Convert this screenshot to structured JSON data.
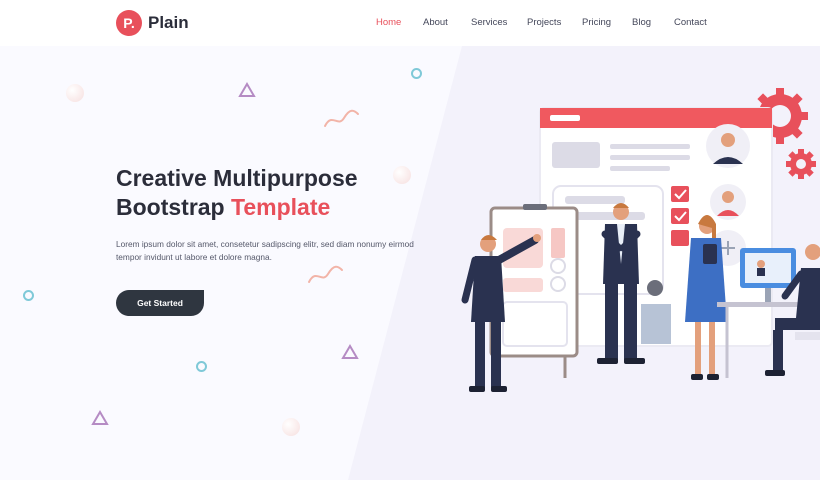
{
  "brand": {
    "badge": "P.",
    "name": "Plain"
  },
  "nav": {
    "items": [
      {
        "label": "Home",
        "active": true
      },
      {
        "label": "About",
        "active": false
      },
      {
        "label": "Services",
        "active": false
      },
      {
        "label": "Projects",
        "active": false
      },
      {
        "label": "Pricing",
        "active": false
      },
      {
        "label": "Blog",
        "active": false
      },
      {
        "label": "Contact",
        "active": false
      }
    ]
  },
  "hero": {
    "title_line1": "Creative Multipurpose",
    "title_line2_prefix": "Bootstrap ",
    "title_line2_accent": "Template",
    "description": "Lorem ipsum dolor sit amet, consetetur sadipscing elitr, sed diam nonumy eirmod tempor invidunt ut labore et dolore magna.",
    "cta_label": "Get Started"
  },
  "colors": {
    "accent": "#e8505b",
    "dark": "#2f3640",
    "background": "#fafaff",
    "panel": "#f3f2fb"
  },
  "illustration": {
    "icon": "team-planning-illustration"
  }
}
